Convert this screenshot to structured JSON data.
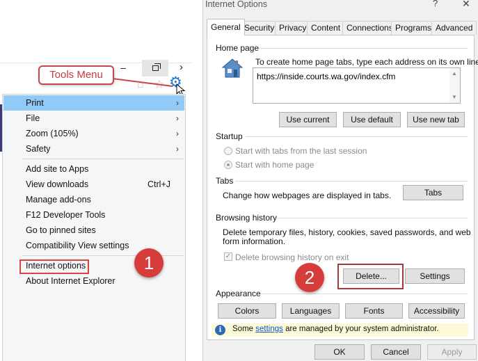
{
  "browser": {
    "window_controls": {
      "minimize": "–",
      "restore": "restore",
      "close": "›"
    },
    "toolbar_icons": [
      "home-icon",
      "favorites-star-icon",
      "tools-gear-icon"
    ]
  },
  "callouts": {
    "tools_menu": "Tools Menu",
    "step1": "1",
    "step2": "2"
  },
  "tools_menu": {
    "items": [
      {
        "label": "Print",
        "arrow": "›",
        "highlighted": true
      },
      {
        "label": "File",
        "arrow": "›"
      },
      {
        "label": "Zoom (105%)",
        "arrow": "›"
      },
      {
        "label": "Safety",
        "arrow": "›"
      },
      {
        "label": "Add site to Apps"
      },
      {
        "label": "View downloads",
        "shortcut": "Ctrl+J"
      },
      {
        "label": "Manage add-ons"
      },
      {
        "label": "F12 Developer Tools"
      },
      {
        "label": "Go to pinned sites"
      },
      {
        "label": "Compatibility View settings"
      },
      {
        "label": "Internet options"
      },
      {
        "label": "About Internet Explorer"
      }
    ]
  },
  "dialog": {
    "title": "Internet Options",
    "help": "?",
    "close": "✕",
    "tabs": [
      "General",
      "Security",
      "Privacy",
      "Content",
      "Connections",
      "Programs",
      "Advanced"
    ],
    "active_tab": "General",
    "home_page": {
      "group_label": "Home page",
      "description": "To create home page tabs, type each address on its own line.",
      "url": "https://inside.courts.wa.gov/index.cfm",
      "buttons": [
        "Use current",
        "Use default",
        "Use new tab"
      ]
    },
    "startup": {
      "group_label": "Startup",
      "options": [
        "Start with tabs from the last session",
        "Start with home page"
      ],
      "selected": "Start with home page"
    },
    "tabs_group": {
      "group_label": "Tabs",
      "description": "Change how webpages are displayed in tabs.",
      "button": "Tabs"
    },
    "browsing_history": {
      "group_label": "Browsing history",
      "description_line1": "Delete temporary files, history, cookies, saved passwords, and web",
      "description_line2": "form information.",
      "checkbox_label": "Delete browsing history on exit",
      "checkbox_checked": true,
      "buttons": [
        "Delete...",
        "Settings"
      ]
    },
    "appearance": {
      "group_label": "Appearance",
      "buttons": [
        "Colors",
        "Languages",
        "Fonts",
        "Accessibility"
      ]
    },
    "info_bar": {
      "prefix": "Some ",
      "link": "settings",
      "suffix": " are managed by your system administrator."
    },
    "footer_buttons": [
      "OK",
      "Cancel",
      "Apply"
    ]
  },
  "colors": {
    "menu_highlight": "#91c9f7",
    "callout_red": "#d63d3a",
    "gear_blue": "#1f75c9",
    "info_bar_bg": "#fdfbd7"
  }
}
